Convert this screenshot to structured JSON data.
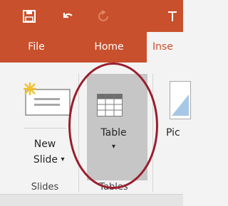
{
  "colors": {
    "accent": "#c8502c",
    "ellipse": "#9a1e2c",
    "ribbon_bg": "#f3f3f3",
    "selected_bg": "#c6c6c6"
  },
  "qat": {
    "icons": [
      "save-icon",
      "undo-icon",
      "redo-icon"
    ]
  },
  "tabs": [
    {
      "label": "File",
      "active": false
    },
    {
      "label": "Home",
      "active": false
    },
    {
      "label": "Inse",
      "active": true
    }
  ],
  "groups": {
    "slides": {
      "label": "Slides",
      "new_slide": {
        "line1": "New",
        "line2": "Slide",
        "dropdown": "▾"
      }
    },
    "tables": {
      "label": "Tables",
      "table": {
        "label": "Table",
        "dropdown": "▾"
      }
    },
    "images": {
      "pictures_label": "Pic"
    }
  }
}
